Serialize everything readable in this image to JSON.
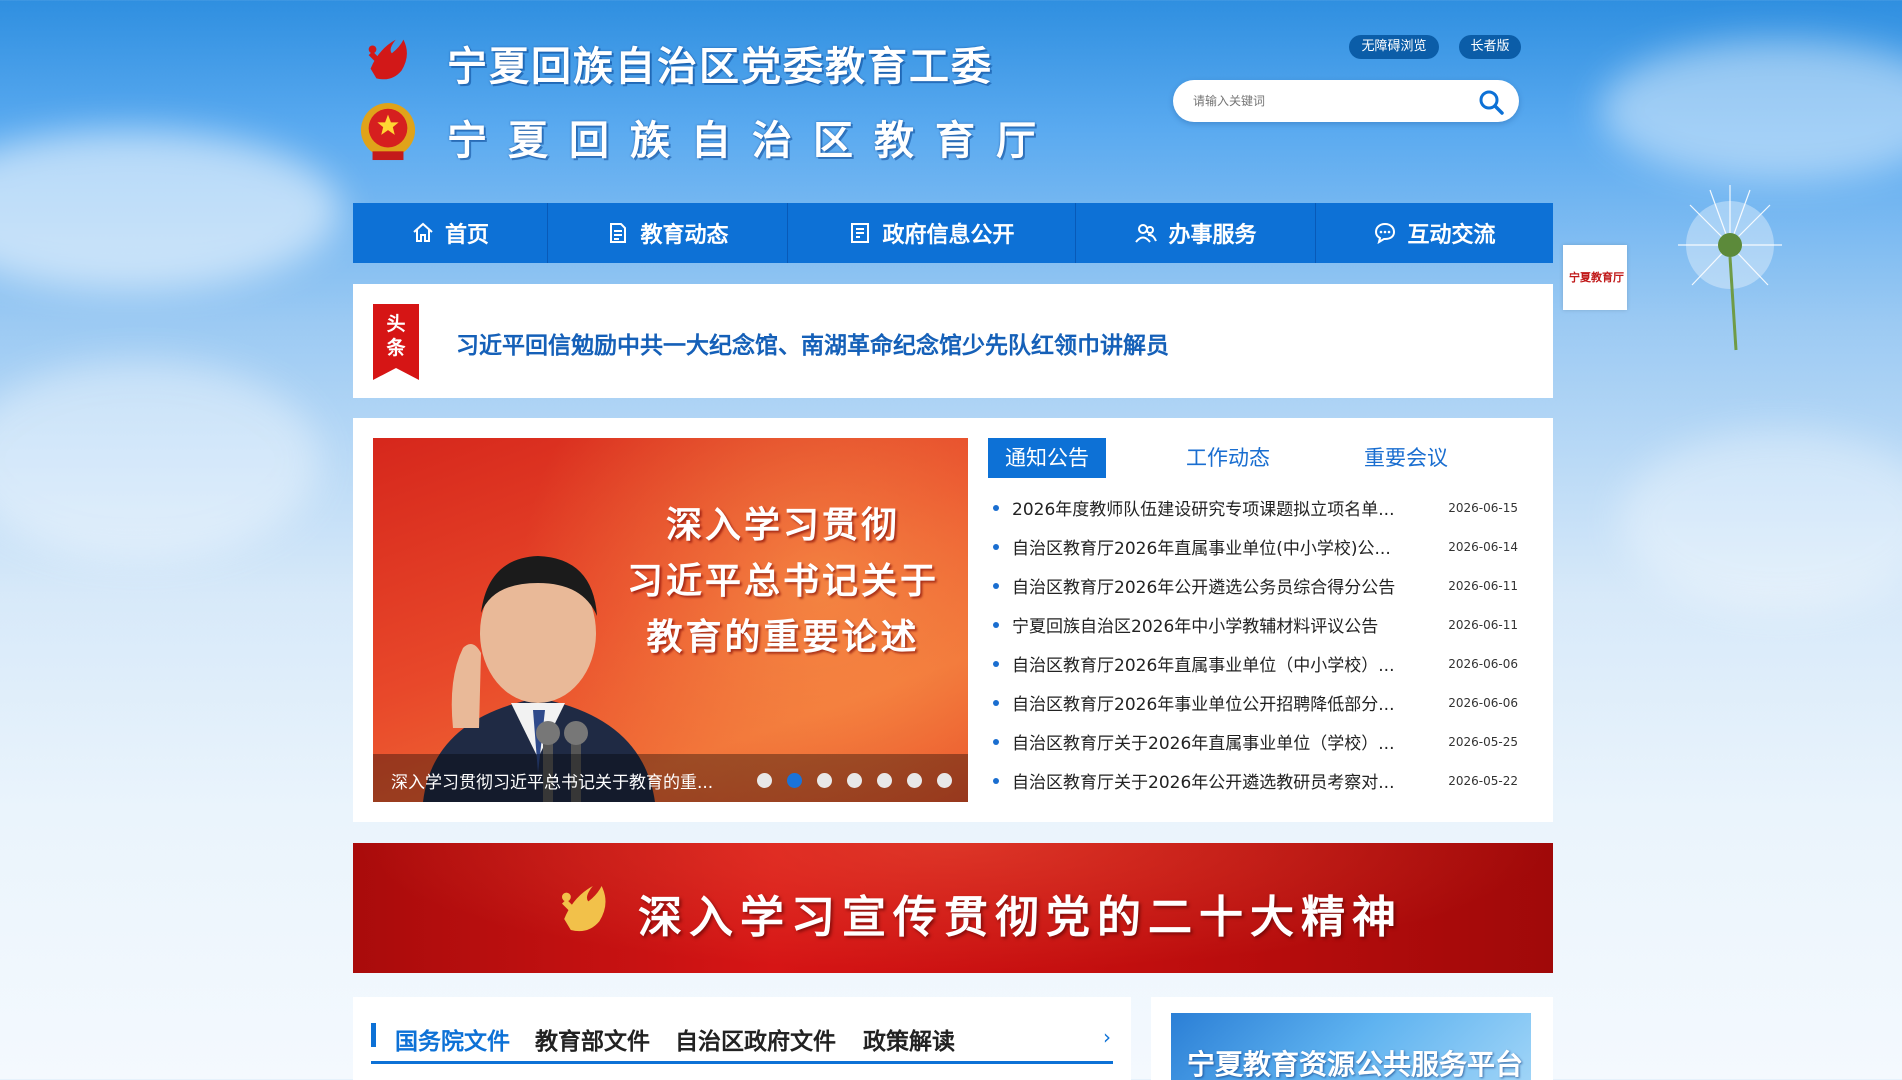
{
  "header": {
    "title_line1": "宁夏回族自治区党委教育工委",
    "title_line2": "宁夏回族自治区教育厅",
    "accessibility_label": "无障碍浏览",
    "elder_label": "长者版",
    "search_placeholder": "请输入关键词"
  },
  "nav": {
    "items": [
      {
        "label": "首页",
        "icon": "home-icon"
      },
      {
        "label": "教育动态",
        "icon": "document-icon"
      },
      {
        "label": "政府信息公开",
        "icon": "list-icon"
      },
      {
        "label": "办事服务",
        "icon": "people-icon"
      },
      {
        "label": "互动交流",
        "icon": "chat-icon"
      }
    ]
  },
  "headline": {
    "ribbon": "头条",
    "text": "习近平回信勉励中共一大纪念馆、南湖革命纪念馆少先队红领巾讲解员"
  },
  "slider": {
    "title_lines": [
      "深入学习贯彻",
      "习近平总书记关于",
      "教育的重要论述"
    ],
    "caption": "深入学习贯彻习近平总书记关于教育的重...",
    "active_dot": 1,
    "dot_count": 7
  },
  "tabs": [
    {
      "label": "通知公告",
      "active": true
    },
    {
      "label": "工作动态",
      "active": false
    },
    {
      "label": "重要会议",
      "active": false
    }
  ],
  "news": [
    {
      "title": "2026年度教师队伍建设研究专项课题拟立项名单...",
      "date": "2026-06-15"
    },
    {
      "title": "自治区教育厅2026年直属事业单位(中小学校)公...",
      "date": "2026-06-14"
    },
    {
      "title": "自治区教育厅2026年公开遴选公务员综合得分公告",
      "date": "2026-06-11"
    },
    {
      "title": "宁夏回族自治区2026年中小学教辅材料评议公告",
      "date": "2026-06-11"
    },
    {
      "title": "自治区教育厅2026年直属事业单位（中小学校）...",
      "date": "2026-06-06"
    },
    {
      "title": "自治区教育厅2026年事业单位公开招聘降低部分...",
      "date": "2026-06-06"
    },
    {
      "title": "自治区教育厅关于2026年直属事业单位（学校）...",
      "date": "2026-05-25"
    },
    {
      "title": "自治区教育厅关于2026年公开遴选教研员考察对...",
      "date": "2026-05-22"
    }
  ],
  "banner": {
    "text": "深入学习宣传贯彻党的二十大精神"
  },
  "policy": {
    "tabs": [
      "国务院文件",
      "教育部文件",
      "自治区政府文件",
      "政策解读"
    ],
    "more": "›"
  },
  "resource": {
    "text": "宁夏教育资源公共服务平台"
  },
  "side_logo": {
    "text": "宁夏教育厅"
  },
  "colors": {
    "nav_blue": "#0d71d6",
    "party_red": "#d61515",
    "link_blue": "#1560b8"
  }
}
